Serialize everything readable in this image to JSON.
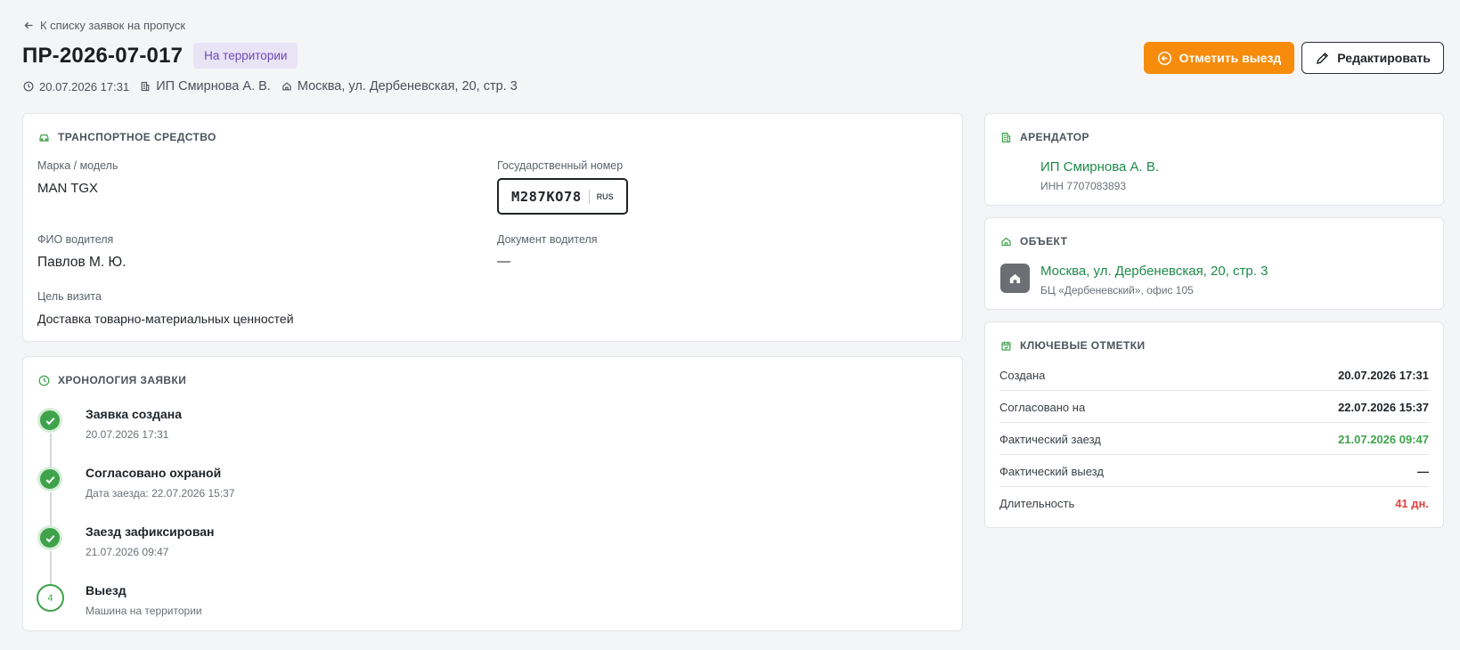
{
  "back_link": "К списку заявок на пропуск",
  "title": "ПР-2026-07-017",
  "status": "На территории",
  "meta": {
    "datetime": "20.07.2026 17:31",
    "tenant": "ИП Смирнова А. В.",
    "address": "Москва, ул. Дербеневская, 20, стр. 3"
  },
  "actions": {
    "checkout_label": "Отметить выезд",
    "edit_label": "Редактировать"
  },
  "vehicle": {
    "header": "ТРАНСПОРТНОЕ СРЕДСТВО",
    "brand_label": "Марка / модель",
    "brand_value": "MAN TGX",
    "plate_label": "Государственный номер",
    "plate_number": "М287КО78",
    "plate_country": "RUS",
    "driver_label": "ФИО водителя",
    "driver_value": "Павлов М. Ю.",
    "doc_label": "Документ водителя",
    "doc_value": "—",
    "purpose_label": "Цель визита",
    "purpose_value": "Доставка товарно-материальных ценностей"
  },
  "timeline": {
    "header": "ХРОНОЛОГИЯ ЗАЯВКИ",
    "steps": [
      {
        "title": "Заявка создана",
        "sub": "20.07.2026 17:31",
        "state": "done"
      },
      {
        "title": "Согласовано охраной",
        "sub": "Дата заезда: 22.07.2026 15:37",
        "state": "done"
      },
      {
        "title": "Заезд зафиксирован",
        "sub": "21.07.2026 09:47",
        "state": "done"
      },
      {
        "title": "Выезд",
        "sub": "Машина на территории",
        "state": "pending",
        "number": "4"
      }
    ]
  },
  "tenant_card": {
    "header": "АРЕНДАТОР",
    "name": "ИП Смирнова А. В.",
    "inn": "ИНН 7707083893"
  },
  "object_card": {
    "header": "ОБЪЕКТ",
    "address": "Москва, ул. Дербеневская, 20, стр. 3",
    "detail": "БЦ «Дербеневский», офис 105"
  },
  "key_marks": {
    "header": "КЛЮЧЕВЫЕ ОТМЕТКИ",
    "rows": [
      {
        "label": "Создана",
        "value": "20.07.2026 17:31",
        "tone": "normal"
      },
      {
        "label": "Согласовано на",
        "value": "22.07.2026 15:37",
        "tone": "normal"
      },
      {
        "label": "Фактический заезд",
        "value": "21.07.2026 09:47",
        "tone": "green"
      },
      {
        "label": "Фактический выезд",
        "value": "—",
        "tone": "normal"
      },
      {
        "label": "Длительность",
        "value": "41 дн.",
        "tone": "red"
      }
    ]
  },
  "colors": {
    "accent_orange": "#f78c0c",
    "green": "#3ea34a",
    "link_green": "#1d8a4a",
    "red": "#e0423a",
    "badge_purple_bg": "#e9e3f6",
    "badge_purple_text": "#6b49b8"
  }
}
